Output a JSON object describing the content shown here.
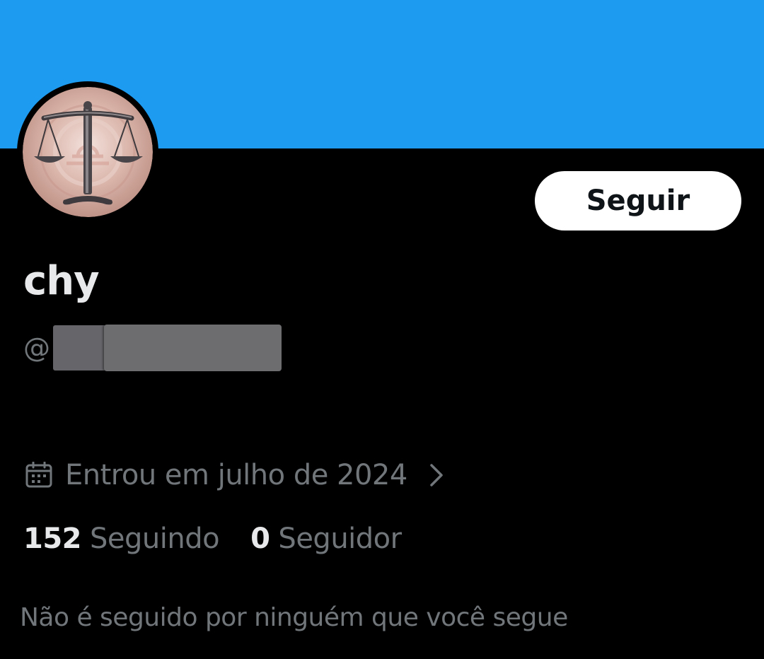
{
  "colors": {
    "banner": "#1d9bf0",
    "background": "#000000",
    "primary_text": "#e7e9ea",
    "secondary_text": "#71767b",
    "follow_button_bg": "#ffffff",
    "follow_button_text": "#0f1419"
  },
  "profile": {
    "display_name": "chy",
    "handle_prefix": "@",
    "avatar_icon": "scales-of-justice-icon",
    "joined": {
      "icon": "calendar-icon",
      "text": "Entrou em julho de 2024",
      "chevron": "chevron-right-icon"
    },
    "stats": {
      "following_count": "152",
      "following_label": "Seguindo",
      "followers_count": "0",
      "followers_label": "Seguidor"
    },
    "followed_by_text": "Não é seguido por ninguém que você segue"
  },
  "actions": {
    "follow_label": "Seguir"
  }
}
